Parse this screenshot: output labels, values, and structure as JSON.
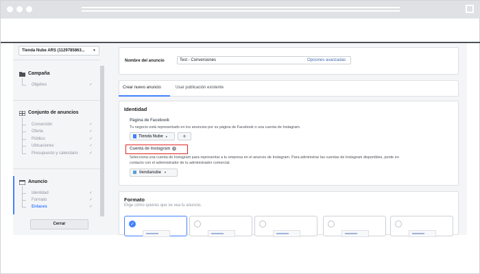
{
  "sidebar": {
    "account_selector": "Tienda Nube ARS (1129785863...",
    "sections": [
      {
        "title": "Campaña",
        "items": [
          {
            "label": "Objetivo",
            "done": true
          }
        ]
      },
      {
        "title": "Conjunto de anuncios",
        "items": [
          {
            "label": "Conversión",
            "done": true
          },
          {
            "label": "Oferta",
            "done": true
          },
          {
            "label": "Público",
            "done": true
          },
          {
            "label": "Ubicaciones",
            "done": true
          },
          {
            "label": "Presupuesto y calendario",
            "done": true
          }
        ]
      },
      {
        "title": "Anuncio",
        "items": [
          {
            "label": "Identidad",
            "done": true
          },
          {
            "label": "Formato",
            "done": true
          },
          {
            "label": "Enlaces",
            "done": true,
            "active": true
          }
        ]
      }
    ],
    "close_button": "Cerrar"
  },
  "ad_name": {
    "label": "Nombre del anuncio",
    "value": "Test - Conversiones",
    "advanced_link": "Opciones avanzadas"
  },
  "tabs": [
    {
      "label": "Crear nuevo anuncio",
      "active": true
    },
    {
      "label": "Usar publicación existente",
      "active": false
    }
  ],
  "identity": {
    "title": "Identidad",
    "facebook_page_label": "Página de Facebook",
    "facebook_page_desc": "Tu negocio está representado en los anuncios por su página de Facebook o una cuenta de Instagram.",
    "facebook_page_value": "Tienda Nube",
    "instagram_label": "Cuenta de Instagram",
    "instagram_desc_line1": "Selecciona una cuenta de Instagram para representar a tu empresa en el anuncio de Instagram. Para administrar las cuentas de Instagram disponibles, ponte en",
    "instagram_desc_line2": "contacto con el administrador de tu administrador comercial.",
    "instagram_value": "tiendanube"
  },
  "format": {
    "title": "Formato",
    "subtitle": "Elige cómo quieres que se vea tu anuncio.",
    "options_selected_index": 0
  },
  "colors": {
    "accent": "#4080ff",
    "highlight": "#e02424",
    "link": "#4267b2"
  }
}
